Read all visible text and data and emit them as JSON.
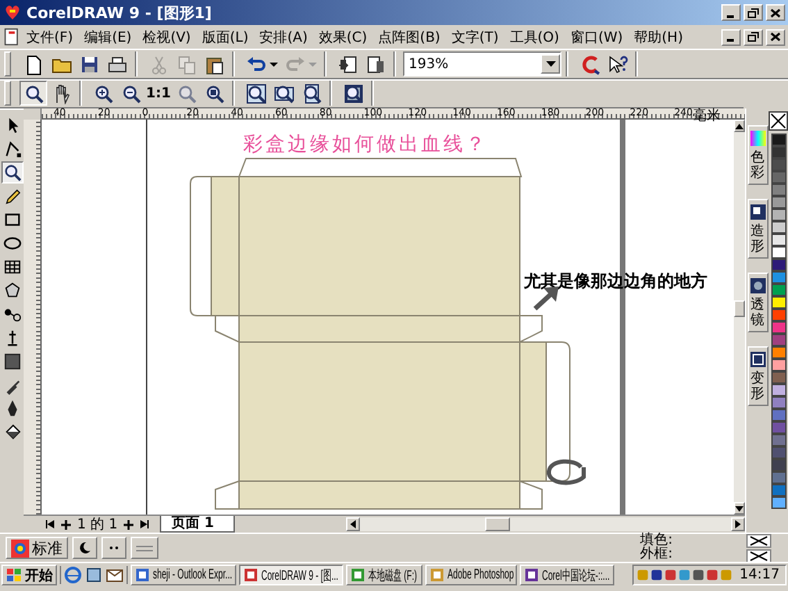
{
  "window": {
    "title": "CorelDRAW 9 - [图形1]"
  },
  "menu": [
    "文件(F)",
    "编辑(E)",
    "检视(V)",
    "版面(L)",
    "安排(A)",
    "效果(C)",
    "点阵图(B)",
    "文字(T)",
    "工具(O)",
    "窗口(W)",
    "帮助(H)"
  ],
  "toolbar": [
    [
      {
        "kind": "new",
        "disabled": false
      },
      {
        "kind": "open",
        "disabled": false
      },
      {
        "kind": "save",
        "disabled": false
      },
      {
        "kind": "print",
        "disabled": false
      }
    ],
    [
      {
        "kind": "cut",
        "disabled": true
      },
      {
        "kind": "copy",
        "disabled": true
      },
      {
        "kind": "paste",
        "disabled": false
      }
    ],
    [
      {
        "kind": "undo",
        "disabled": false
      },
      {
        "kind": "redo",
        "disabled": true
      }
    ],
    [
      {
        "kind": "import",
        "disabled": false
      },
      {
        "kind": "export",
        "disabled": false
      }
    ],
    [
      {
        "kind": "zoomcombo",
        "value": "193%"
      }
    ],
    [
      {
        "kind": "corel",
        "disabled": false
      },
      {
        "kind": "whatsthis",
        "disabled": false
      }
    ]
  ],
  "zoom_toolbar": [
    [
      {
        "kind": "zoom",
        "selected": true
      },
      {
        "kind": "hand",
        "selected": false
      }
    ],
    [
      {
        "kind": "zoomin",
        "selected": false
      },
      {
        "kind": "zoomout",
        "selected": false
      },
      {
        "kind": "actual",
        "label": "1:1",
        "selected": false
      },
      {
        "kind": "zoomsel",
        "selected": false
      },
      {
        "kind": "zoomall",
        "selected": false
      }
    ],
    [
      {
        "kind": "zoompage",
        "selected": false
      },
      {
        "kind": "zoomwidth",
        "selected": false
      },
      {
        "kind": "zoomheight",
        "selected": false
      }
    ],
    [
      {
        "kind": "zoomwin",
        "selected": false
      }
    ]
  ],
  "ruler": {
    "labels": [
      "40",
      "20",
      "0",
      "20",
      "40",
      "60",
      "80",
      "100",
      "120",
      "140",
      "160",
      "180",
      "200",
      "220",
      "240"
    ],
    "unit": "毫米"
  },
  "toolbox": [
    {
      "kind": "pick",
      "selected": false
    },
    {
      "kind": "shape",
      "selected": false
    },
    {
      "kind": "zoom",
      "selected": true
    },
    {
      "kind": "freehand",
      "selected": false
    },
    {
      "kind": "rect",
      "selected": false
    },
    {
      "kind": "ellipse",
      "selected": false
    },
    {
      "kind": "grid",
      "selected": false
    },
    {
      "kind": "polygon",
      "selected": false
    },
    {
      "kind": "blend",
      "selected": false
    },
    {
      "kind": "transparency",
      "selected": false
    },
    {
      "kind": "fillsq",
      "selected": false
    },
    {
      "kind": "eyedropper",
      "selected": false
    },
    {
      "kind": "pen",
      "selected": false
    },
    {
      "kind": "bucket",
      "selected": false
    }
  ],
  "canvas": {
    "heading": "彩盒边缘如何做出血线？",
    "note": "尤其是像那边边角的地方"
  },
  "dockers": [
    "色彩",
    "造形",
    "透镜",
    "变形"
  ],
  "palette": [
    {
      "kind": "none"
    },
    {
      "kind": "swatch",
      "color": "#1a1a1a"
    },
    {
      "kind": "swatch",
      "color": "#333333"
    },
    {
      "kind": "swatch",
      "color": "#4d4d4d"
    },
    {
      "kind": "swatch",
      "color": "#666666"
    },
    {
      "kind": "swatch",
      "color": "#808080"
    },
    {
      "kind": "swatch",
      "color": "#999999"
    },
    {
      "kind": "swatch",
      "color": "#b3b3b3"
    },
    {
      "kind": "swatch",
      "color": "#cccccc"
    },
    {
      "kind": "swatch",
      "color": "#e6e6e6"
    },
    {
      "kind": "swatch",
      "color": "#ffffff"
    },
    {
      "kind": "swatch",
      "color": "#2e1a78"
    },
    {
      "kind": "swatch",
      "color": "#1e90e0"
    },
    {
      "kind": "swatch",
      "color": "#00a050"
    },
    {
      "kind": "swatch",
      "color": "#ffee00"
    },
    {
      "kind": "swatch",
      "color": "#ff4000"
    },
    {
      "kind": "swatch",
      "color": "#ee3388"
    },
    {
      "kind": "swatch",
      "color": "#a04080"
    },
    {
      "kind": "swatch",
      "color": "#ff8000"
    },
    {
      "kind": "swatch",
      "color": "#ffa0a0"
    },
    {
      "kind": "swatch",
      "color": "#806050"
    },
    {
      "kind": "swatch",
      "color": "#c0b0e0"
    },
    {
      "kind": "swatch",
      "color": "#9080c0"
    },
    {
      "kind": "swatch",
      "color": "#6070c0"
    },
    {
      "kind": "swatch",
      "color": "#7050a0"
    },
    {
      "kind": "swatch",
      "color": "#707090"
    },
    {
      "kind": "swatch",
      "color": "#505070"
    },
    {
      "kind": "swatch",
      "color": "#404050"
    },
    {
      "kind": "swatch",
      "color": "#607090"
    },
    {
      "kind": "swatch",
      "color": "#1070c0"
    },
    {
      "kind": "swatch",
      "color": "#60b0ff"
    }
  ],
  "page_nav": {
    "count": "1 的 1",
    "tabs": [
      {
        "label": "页面 1",
        "selected": true
      }
    ]
  },
  "status": {
    "style": "标准",
    "fill_label": "填色:",
    "outline_label": "外框:"
  },
  "taskbar": {
    "start": "开始",
    "tasks": [
      {
        "label": "sheji - Outlook Expr...",
        "selected": false
      },
      {
        "label": "CorelDRAW 9 - [图...",
        "selected": true
      },
      {
        "label": "本地磁盘 (F:)",
        "selected": false
      },
      {
        "label": "Adobe Photoshop",
        "selected": false
      },
      {
        "label": "Corel中国论坛-::...",
        "selected": false
      }
    ],
    "clock": "14:17"
  }
}
